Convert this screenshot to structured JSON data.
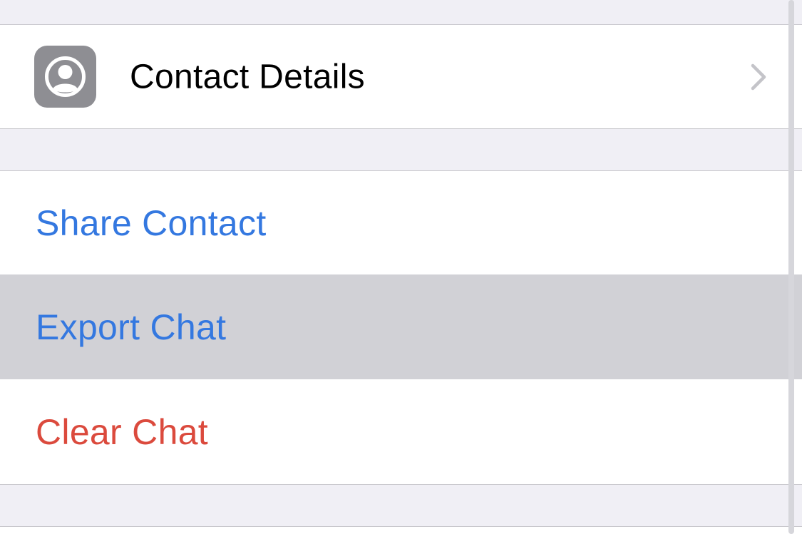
{
  "contact_section": {
    "details_label": "Contact Details",
    "icon": "person-circle-icon",
    "chevron_icon": "chevron-right-icon"
  },
  "actions": {
    "share_contact": "Share Contact",
    "export_chat": "Export Chat",
    "clear_chat": "Clear Chat"
  },
  "colors": {
    "background": "#f0eff5",
    "action_blue": "#3478e0",
    "destructive_red": "#db4a3d",
    "pressed_row": "#d1d1d6",
    "icon_gray": "#8e8e93"
  }
}
